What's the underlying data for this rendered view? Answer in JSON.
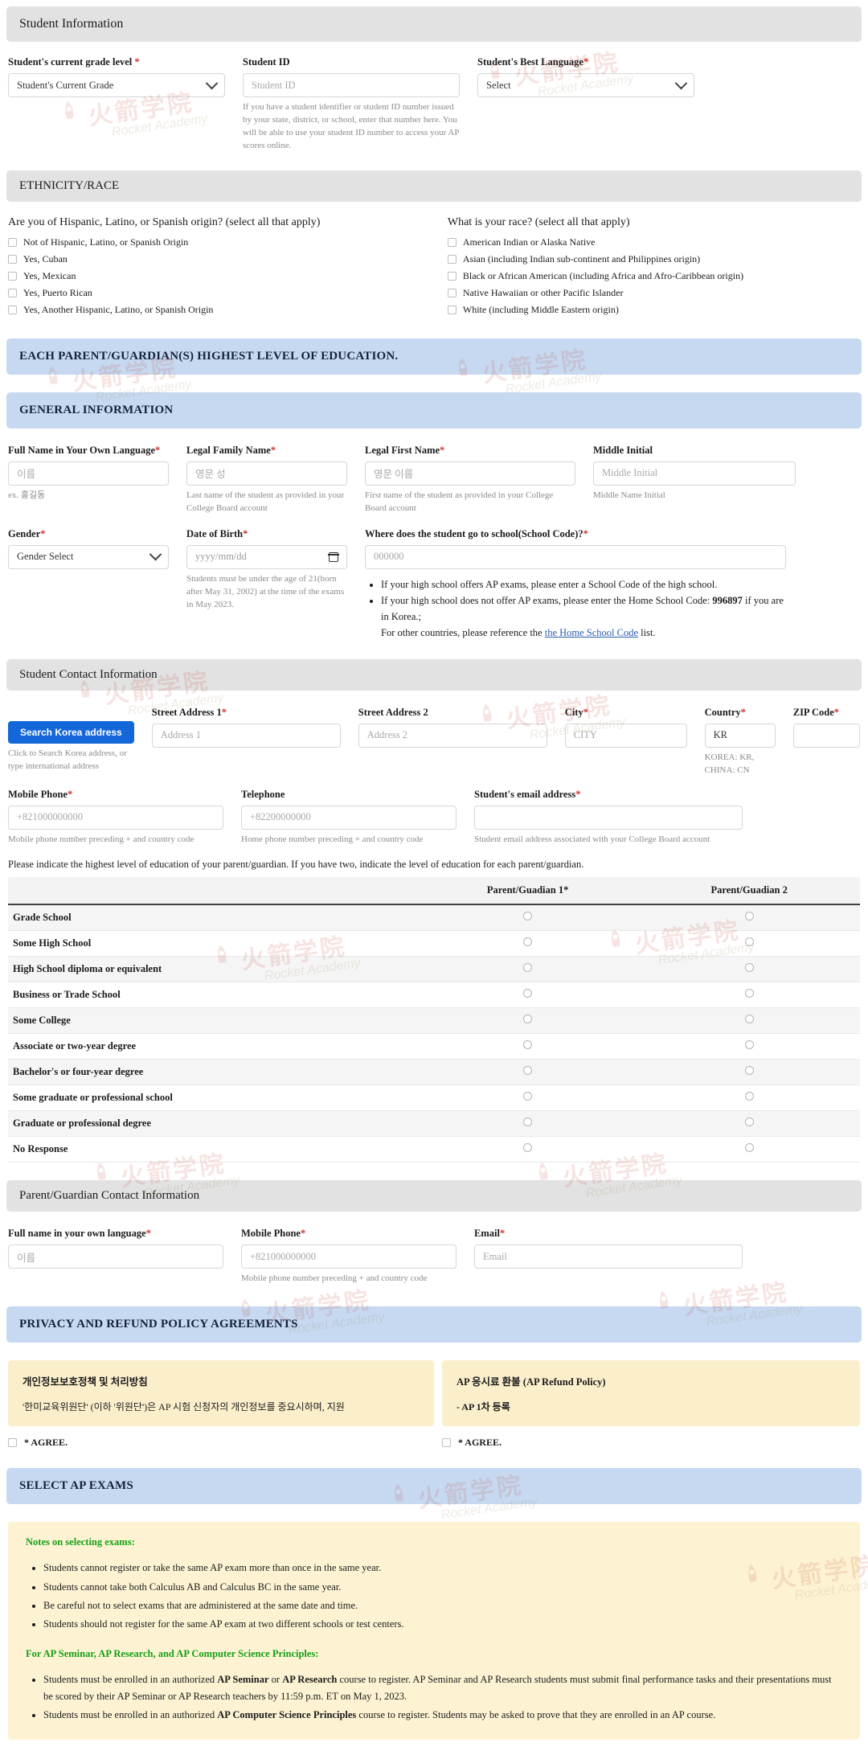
{
  "student_information": {
    "section_title": "Student Information",
    "grade": {
      "label": "Student's current grade level",
      "required": "*",
      "value": "Student's Current Grade"
    },
    "student_id": {
      "label": "Student ID",
      "placeholder": "Student ID",
      "hint": "If you have a student identifier or student ID number issued by your state, district, or school, enter that number here. You will be able to use your student ID number to access your AP scores online."
    },
    "best_language": {
      "label": "Student's Best Language",
      "required": "*",
      "value": "Select"
    }
  },
  "ethnicity": {
    "section_title": "ETHNICITY/RACE",
    "hispanic_question": "Are you of Hispanic, Latino, or Spanish origin? (select all that apply)",
    "hispanic_options": [
      "Not of Hispanic, Latino, or Spanish Origin",
      "Yes, Cuban",
      "Yes, Mexican",
      "Yes, Puerto Rican",
      "Yes, Another Hispanic, Latino, or Spanish Origin"
    ],
    "race_question": "What is your race? (select all that apply)",
    "race_options": [
      "American Indian or Alaska Native",
      "Asian (including Indian sub-continent and Philippines origin)",
      "Black or African American (including Africa and Afro-Caribbean origin)",
      "Native Hawaiian or other Pacific Islander",
      "White (including Middle Eastern origin)"
    ]
  },
  "education_banner": "EACH PARENT/GUARDIAN(S) HIGHEST LEVEL OF EDUCATION.",
  "general_information": {
    "section_title": "GENERAL INFORMATION",
    "full_name_own_language": {
      "label": "Full Name in Your Own Language",
      "required": "*",
      "placeholder": "이름",
      "hint": "ex. 홍길동"
    },
    "legal_family_name": {
      "label": "Legal Family Name",
      "required": "*",
      "placeholder": "영문 성",
      "hint": "Last name of the student as provided in your College Board account"
    },
    "legal_first_name": {
      "label": "Legal First Name",
      "required": "*",
      "placeholder": "영문 이름",
      "hint": "First name of the student as provided in your College Board account"
    },
    "middle_initial": {
      "label": "Middle Initial",
      "placeholder": "Middle Initial",
      "hint": "Middle Name Initial"
    },
    "gender": {
      "label": "Gender",
      "required": "*",
      "value": "Gender Select"
    },
    "date_of_birth": {
      "label": "Date of Birth",
      "required": "*",
      "placeholder": "yyyy/mm/dd",
      "hint": "Students must be under the age of 21(born after May 31, 2002) at the time of the exams in May 2023."
    },
    "school_code": {
      "label": "Where does the student go to school(School Code)?",
      "required": "*",
      "placeholder": "000000",
      "bullets": [
        "If your high school offers AP exams, please enter a School Code of the high school.",
        "If your high school does not offer AP exams, please enter the Home School Code: 996897 if you are in Korea.;",
        "For other countries, please reference the the Home School Code list."
      ],
      "home_school_code": "996897",
      "link_text": "the Home School Code"
    }
  },
  "student_contact": {
    "section_title": "Student Contact Information",
    "search_button": "Search Korea address",
    "search_hint": "Click to Search Korea address, or type international address",
    "street1": {
      "label": "Street Address 1",
      "required": "*",
      "placeholder": "Address 1"
    },
    "street2": {
      "label": "Street Address 2",
      "placeholder": "Address 2"
    },
    "city": {
      "label": "City",
      "required": "*",
      "placeholder": "CITY"
    },
    "country": {
      "label": "Country",
      "required": "*",
      "value": "KR",
      "hint": "KOREA: KR, CHINA: CN"
    },
    "zip": {
      "label": "ZIP Code",
      "required": "*",
      "placeholder": ""
    },
    "mobile": {
      "label": "Mobile Phone",
      "required": "*",
      "placeholder": "+821000000000",
      "hint": "Mobile phone number preceding + and country code"
    },
    "telephone": {
      "label": "Telephone",
      "placeholder": "+82200000000",
      "hint": "Home phone number preceding + and country code"
    },
    "email": {
      "label": "Student's email address",
      "required": "*",
      "placeholder": "",
      "hint": "Student email address associated with your College Board account"
    }
  },
  "parent_education": {
    "intro": "Please indicate the highest level of education of your parent/guardian. If you have two, indicate the level of education for each parent/guardian.",
    "columns": [
      "",
      "Parent/Guadian 1",
      "Parent/Guadian 2"
    ],
    "col1_required": "*",
    "rows": [
      "Grade School",
      "Some High School",
      "High School diploma or equivalent",
      "Business or Trade School",
      "Some College",
      "Associate or two-year degree",
      "Bachelor's or four-year degree",
      "Some graduate or professional school",
      "Graduate or professional degree",
      "No Response"
    ]
  },
  "parent_contact": {
    "section_title": "Parent/Guardian Contact Information",
    "full_name": {
      "label": "Full name in your own language",
      "required": "*",
      "placeholder": "이름"
    },
    "mobile": {
      "label": "Mobile Phone",
      "required": "*",
      "placeholder": "+821000000000",
      "hint": "Mobile phone number preceding + and country code"
    },
    "email": {
      "label": "Email",
      "required": "*",
      "placeholder": "Email"
    }
  },
  "privacy": {
    "banner": "PRIVACY AND REFUND POLICY AGREEMENTS",
    "left": {
      "heading": "개인정보보호정책 및 처리방침",
      "body": "'한미교육위원단' (이하 '위원단')은 AP 시험 신청자의 개인정보를 중요시하며, 지원",
      "agree": "* AGREE."
    },
    "right": {
      "heading": "AP 응시료 환불 (AP Refund Policy)",
      "body": "- AP 1차 등록",
      "agree": "* AGREE."
    }
  },
  "select_exams": {
    "banner": "SELECT AP EXAMS",
    "notes_heading": "Notes on selecting exams:",
    "notes": [
      "Students cannot register or take the same AP exam more than once in the same year.",
      "Students cannot take both Calculus AB and Calculus BC in the same year.",
      "Be careful not to select exams that are administered at the same date and time.",
      "Students should not register for the same AP exam at two different schools or test centers."
    ],
    "seminar_heading": "For AP Seminar, AP Research, and AP Computer Science Principles:",
    "seminar_notes": [
      "Students must be enrolled in an authorized AP Seminar or AP Research course to register. AP Seminar and AP Research students must submit final performance tasks and their presentations must be scored by their AP Seminar or AP Research teachers by 11:59 p.m. ET on May 1, 2023.",
      "Students must be enrolled in an authorized AP Computer Science Principles course to register. Students may be asked to prove that they are enrolled in an AP course."
    ]
  },
  "watermark": {
    "cn": "火箭学院",
    "en": "Rocket Academy"
  },
  "colors": {
    "banner_blue": "#c6d9f1",
    "banner_grey": "#e2e2e2",
    "button_blue": "#1367d8",
    "policy_beige": "#fbeecb",
    "notes_beige": "#fdf3d3",
    "required_red": "#d0342c",
    "green": "#16a016"
  }
}
